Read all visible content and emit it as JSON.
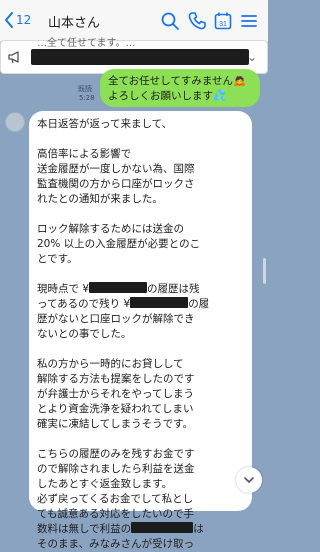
{
  "header": {
    "back_label": "<",
    "unread_count": "12",
    "title": "山本さん",
    "icons": [
      "search-icon",
      "phone-icon",
      "calendar-icon",
      "menu-icon"
    ],
    "calendar_day": "31"
  },
  "announcement": {
    "text": "…全て任せてます。…"
  },
  "sent_message": {
    "lines": [
      "全てお任せしてすみません🙇",
      "よろしくお願いします💦"
    ],
    "read_label": "既読",
    "time": "5:28"
  },
  "received_message": {
    "p1": [
      "本日返答が返って来まして、"
    ],
    "p2": [
      "高倍率による影響で",
      "送金履歴が一度しかない為、国際",
      "監査機関の方から口座がロックさ",
      "れたとの通知が来ました。"
    ],
    "p3": [
      "ロック解除するためには送金の",
      "20% 以上の入金履歴が必要とのこ",
      "とです。"
    ],
    "p4": {
      "l1a": "現時点で ¥",
      "l1b": "の履歴は残",
      "l2a": "ってあるので残り ¥",
      "l2b": "の履",
      "l3": "歴がないと口座ロックが解除でき",
      "l4": "ないとの事でした。"
    },
    "p5": [
      "私の方から一時的にお貸しして",
      "解除する方法も提案をしたのです",
      "が弁護士からそれをやってしまう",
      "とより資金洗浄を疑われてしまい",
      "確実に凍結してしまうそうです。"
    ],
    "p6": {
      "lines": [
        "こちらの履歴のみを残すお金です",
        "ので解除されましたら利益を送金",
        "したあとすぐ返金致します。",
        "必ず戻ってくるお金でして私とし",
        "ても誠意ある対応をしたいので手"
      ],
      "l6a": "数料は無しで利益の",
      "l6b": "は",
      "l7": "そのまま、みなみさんが受け取っ"
    }
  },
  "colors": {
    "background": "#8aa3c1",
    "sent_bubble": "#8de055",
    "accent": "#1874e8"
  }
}
